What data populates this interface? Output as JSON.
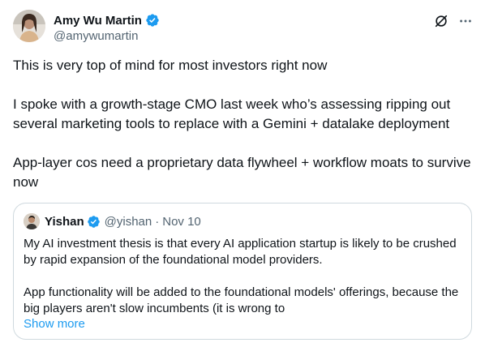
{
  "author": {
    "display_name": "Amy Wu Martin",
    "handle": "@amywumartin"
  },
  "tweet": {
    "text": "This is very top of mind for most investors right now\n\nI spoke with a growth-stage CMO last week who’s assessing ripping out several marketing tools to replace with a Gemini + datalake deployment\n\nApp-layer cos need a proprietary data flywheel + workflow moats to survive now"
  },
  "quote": {
    "display_name": "Yishan",
    "handle": "@yishan",
    "separator": "·",
    "date": "Nov 10",
    "text": "My AI investment thesis is that every AI application startup is likely to be crushed by rapid expansion of the foundational model providers.\n\nApp functionality will be added to the foundational models' offerings, because the big players aren't slow incumbents (it is wrong to",
    "show_more_label": "Show more"
  },
  "colors": {
    "text": "#0f1419",
    "muted": "#536471",
    "link": "#1d9bf0",
    "verified": "#1d9bf0",
    "border": "#cfd9de"
  },
  "icons": {
    "verified": "verified-badge-icon",
    "grok": "grok-icon",
    "more": "more-horizontal-icon"
  }
}
